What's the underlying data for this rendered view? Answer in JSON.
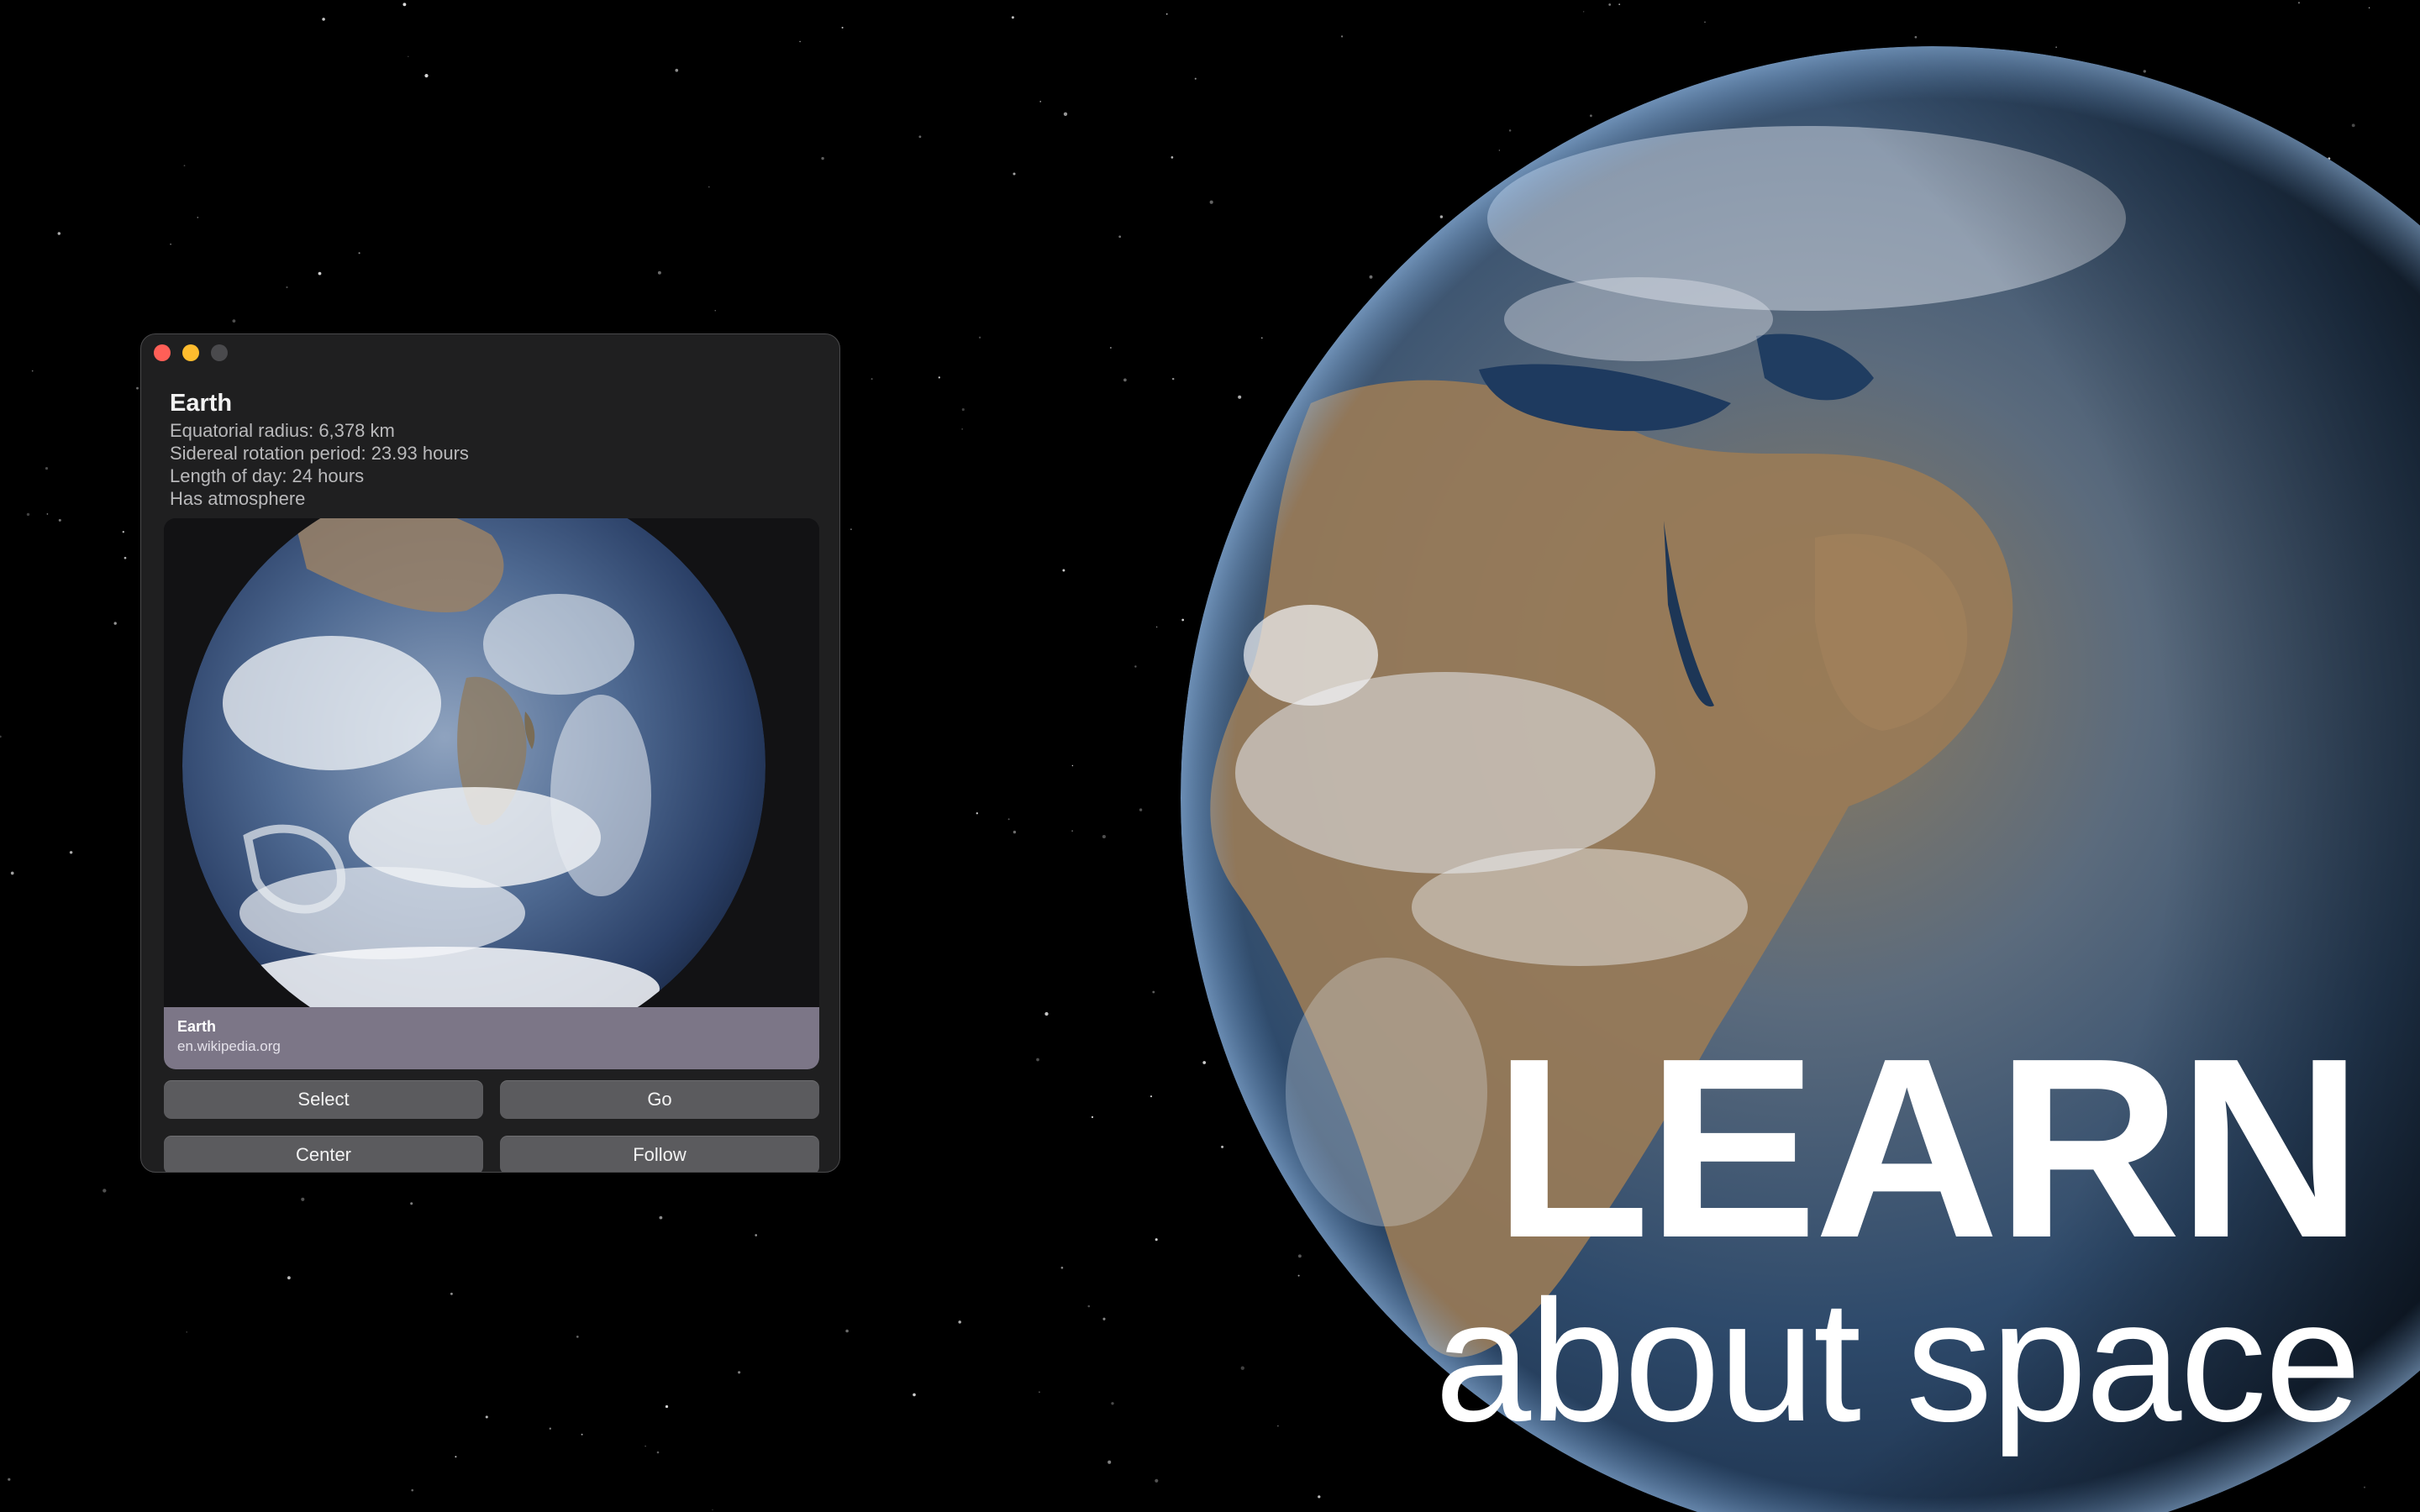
{
  "window": {
    "title": "Earth",
    "facts": [
      "Equatorial radius: 6,378 km",
      "Sidereal rotation period: 23.93 hours",
      "Length of day: 24 hours",
      "Has atmosphere"
    ],
    "preview": {
      "title": "Earth",
      "source": "en.wikipedia.org"
    },
    "buttons": {
      "select": "Select",
      "go": "Go",
      "center": "Center",
      "follow": "Follow"
    }
  },
  "headline": {
    "line1": "LEARN",
    "line2": "about space"
  },
  "colors": {
    "window_bg": "#1f1f20",
    "preview_footer": "#7c7687",
    "button_bg": "#5b5b5e",
    "close": "#ff5f57",
    "minimize": "#febc2e"
  },
  "icons": [
    "close-icon",
    "minimize-icon",
    "zoom-icon"
  ]
}
